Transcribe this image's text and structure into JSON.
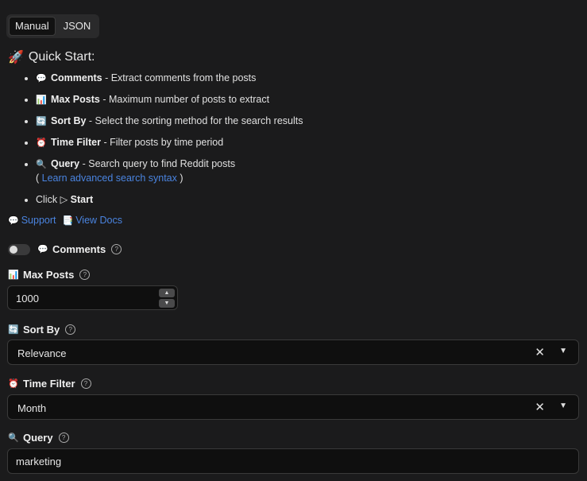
{
  "tabs": [
    {
      "label": "Manual",
      "active": true
    },
    {
      "label": "JSON",
      "active": false
    }
  ],
  "quick_start": {
    "icon": "rocket-icon",
    "title": "Quick Start:",
    "items": [
      {
        "icon": "💬",
        "name": "Comments",
        "desc": " - Extract comments from the posts"
      },
      {
        "icon": "📊",
        "name": "Max Posts",
        "desc": " - Maximum number of posts to extract"
      },
      {
        "icon": "🔄",
        "name": "Sort By",
        "desc": " - Select the sorting method for the search results"
      },
      {
        "icon": "⏰",
        "name": "Time Filter",
        "desc": " - Filter posts by time period"
      },
      {
        "icon": "🔍",
        "name": "Query",
        "desc": " - Search query to find Reddit posts",
        "link_open": "( ",
        "link": "Learn advanced search syntax",
        "link_close": " )"
      },
      {
        "prefix": "Click ",
        "play": "▷",
        "name": "Start"
      }
    ]
  },
  "links": {
    "support": "Support",
    "docs": "View Docs"
  },
  "fields": {
    "comments": {
      "label": "Comments",
      "enabled": false
    },
    "max_posts": {
      "label": "Max Posts",
      "value": "1000"
    },
    "sort_by": {
      "label": "Sort By",
      "value": "Relevance"
    },
    "time_filter": {
      "label": "Time Filter",
      "value": "Month"
    },
    "query": {
      "label": "Query",
      "value": "marketing"
    }
  },
  "help_glyph": "?"
}
